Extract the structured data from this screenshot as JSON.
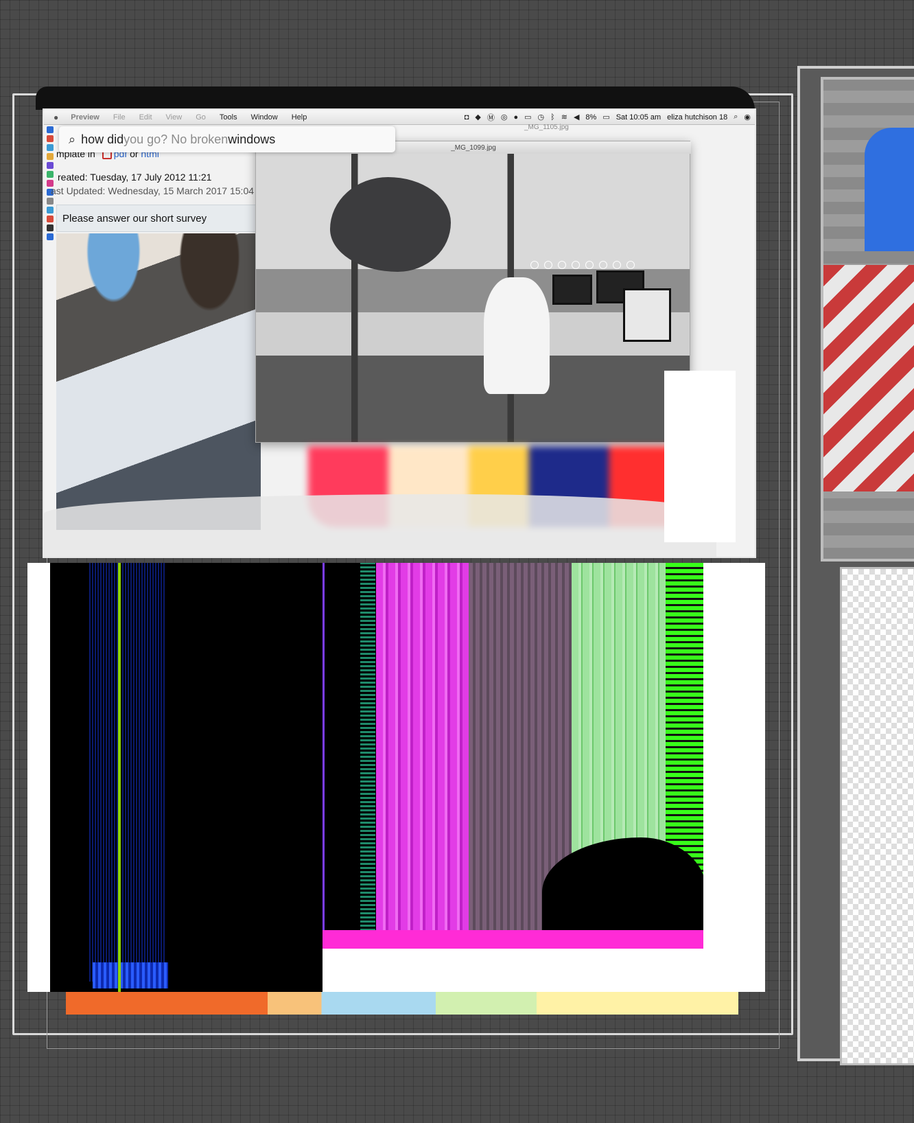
{
  "menubar": {
    "apple": "",
    "items": [
      {
        "label": "Preview",
        "style": "bold"
      },
      {
        "label": "File",
        "style": "dim"
      },
      {
        "label": "Edit",
        "style": "dim"
      },
      {
        "label": "View",
        "style": "dim"
      },
      {
        "label": "Go",
        "style": "dim"
      },
      {
        "label": "Tools",
        "style": "normal"
      },
      {
        "label": "Window",
        "style": "normal"
      },
      {
        "label": "Help",
        "style": "normal"
      }
    ],
    "battery": "8%",
    "clock": "Sat 10:05 am",
    "user": "eliza hutchison 18",
    "icons": [
      "camera-icon",
      "dropbox-icon",
      "m-icon",
      "creative-cloud-icon",
      "evernote-icon",
      "airplay-icon",
      "time-machine-icon",
      "bluetooth-icon",
      "wifi-icon",
      "volume-icon",
      "battery-icon",
      "search-icon",
      "siri-icon"
    ]
  },
  "search": {
    "typed": "how did ",
    "ghost": "you go? No broken ",
    "rest": "windows"
  },
  "document": {
    "template_prefix": "mplate in",
    "pdf_link": "pdf",
    "or_text": "or",
    "html_link": "html",
    "created": "reated: Tuesday, 17 July 2012 11:21",
    "updated": "ast Updated: Wednesday, 15 March 2017 15:04",
    "survey": "Please answer our short survey"
  },
  "preview_window": {
    "title": "_MG_1099.jpg",
    "back_title": "_MG_1105.jpg"
  },
  "colors": {
    "traffic_red": "#fc605c",
    "traffic_yellow": "#fdbc40",
    "traffic_green": "#34c84a",
    "link": "#2762c7"
  }
}
